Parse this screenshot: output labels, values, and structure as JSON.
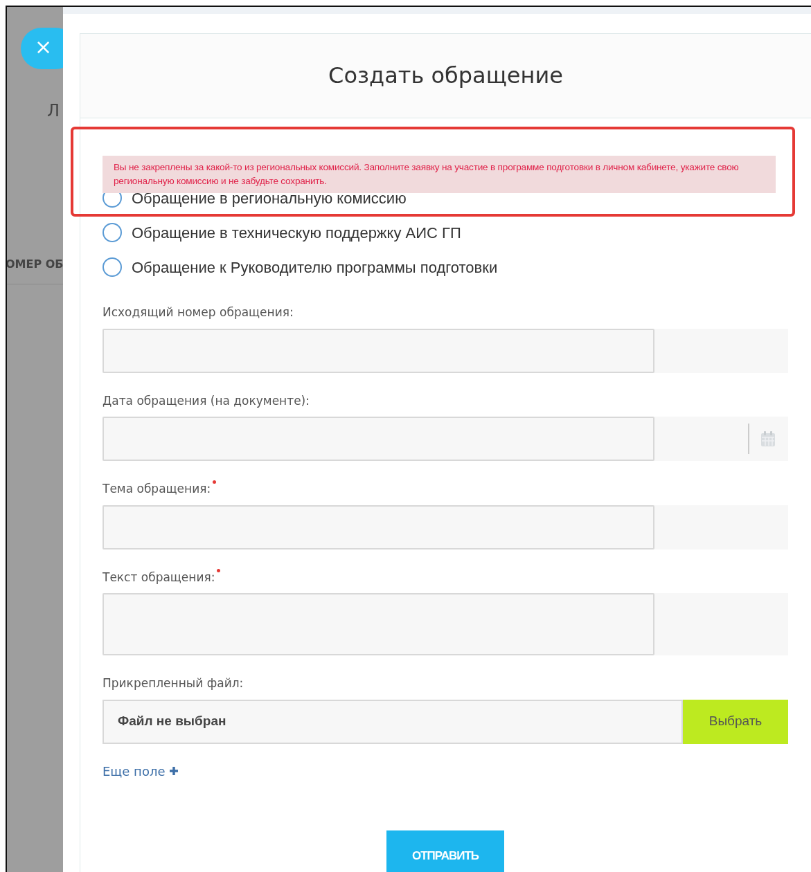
{
  "background": {
    "close_button": "×",
    "heading": "Л",
    "column_header": "ОМЕР ОБ"
  },
  "modal": {
    "title": "Создать обращение",
    "tooltip": "Вы не закреплены за какой-то из региональных комиссий. Заполните заявку на участие в программе подготовки в личном кабинете, укажите свою региональную комиссию и не забудьте сохранить.",
    "radios": [
      {
        "label": "Обращение в региональную комиссию",
        "selected": false
      },
      {
        "label": "Обращение в техническую поддержку АИС ГП",
        "selected": false
      },
      {
        "label": "Обращение к Руководителю программы подготовки",
        "selected": false
      }
    ],
    "fields": [
      {
        "kind": "text",
        "label": "Исходящий номер обращения:",
        "required": false
      },
      {
        "kind": "date",
        "label": "Дата обращения (на документе):",
        "required": false
      },
      {
        "kind": "text",
        "label": "Тема обращения:",
        "required": true
      },
      {
        "kind": "textarea",
        "label": "Текст обращения:",
        "required": true
      },
      {
        "kind": "file",
        "label": "Прикрепленный файл:",
        "required": false,
        "value": "Файл не выбран",
        "button": "Выбрать"
      }
    ],
    "add_field": "Еще поле",
    "submit": "ОТПРАВИТЬ"
  }
}
